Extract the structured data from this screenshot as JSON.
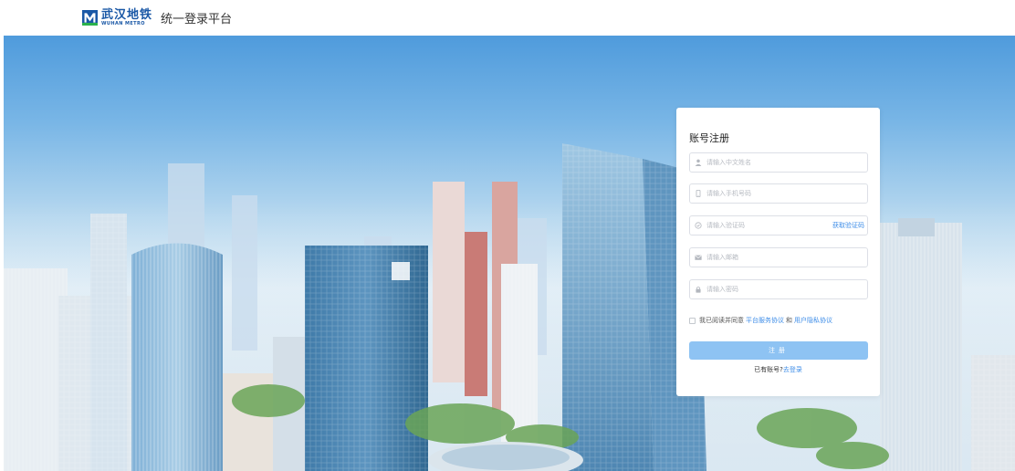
{
  "header": {
    "logo_cn": "武汉地铁",
    "logo_en": "WUHAN METRO",
    "title": "统一登录平台"
  },
  "colors": {
    "brand": "#1a58a6",
    "link": "#3f8ee8",
    "submit_bg": "#8ec3f3"
  },
  "form": {
    "title": "账号注册",
    "name": {
      "placeholder": "请输入中文姓名",
      "icon": "user-icon"
    },
    "phone": {
      "placeholder": "请输入手机号码",
      "icon": "phone-icon"
    },
    "code": {
      "placeholder": "请输入验证码",
      "icon": "shield-icon",
      "action": "获取验证码"
    },
    "email": {
      "placeholder": "请输入邮箱",
      "icon": "mail-icon"
    },
    "password": {
      "placeholder": "请输入密码",
      "icon": "lock-icon"
    },
    "agree": {
      "prefix": "我已阅读并同意",
      "service_link": "平台服务协议",
      "joiner": "和",
      "privacy_link": "用户隐私协议"
    },
    "submit_label": "注册",
    "login_prompt": "已有账号?",
    "login_link": "去登录"
  }
}
